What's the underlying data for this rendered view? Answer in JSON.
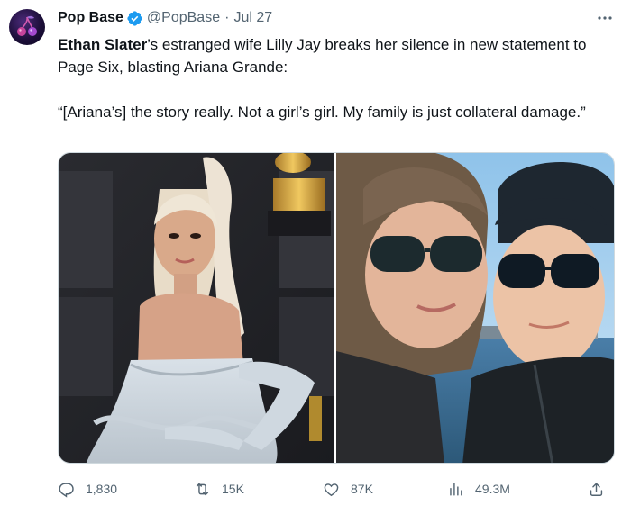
{
  "tweet": {
    "author_name": "Pop Base",
    "handle": "@PopBase",
    "separator": "·",
    "date": "Jul 27",
    "text_name": "Ethan Slater",
    "text_line1_rest": "’s estranged wife Lilly Jay breaks her silence in new statement to Page Six, blasting Ariana Grande:",
    "text_quote": "“[Ariana’s] the story really. Not a girl’s girl. My family is just collateral damage.”"
  },
  "icons": {
    "avatar": "cherry-logo-icon",
    "verified": "verified-badge-icon",
    "more": "more-dots-icon",
    "reply": "reply-icon",
    "retweet": "retweet-icon",
    "like": "heart-icon",
    "views": "views-chart-icon",
    "share": "share-icon"
  },
  "stats": {
    "replies": "1,830",
    "retweets": "15K",
    "likes": "87K",
    "views": "49.3M"
  },
  "colors": {
    "verified": "#1d9bf0",
    "secondary_text": "#536471",
    "primary_text": "#0f1419"
  }
}
